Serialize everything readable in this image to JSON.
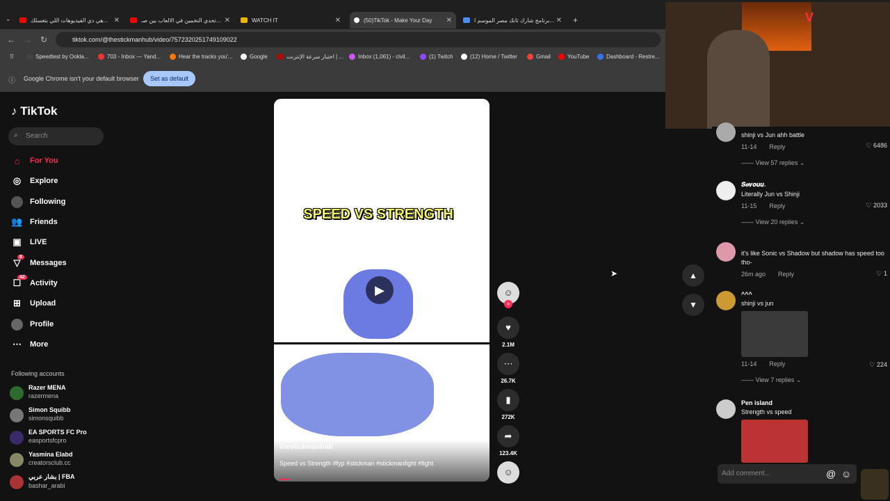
{
  "tabs": [
    {
      "label": "هي دي الفيديوهات اللي بتغسلك..."
    },
    {
      "label": "تحدي التخمين في الالعاب بين صـ..."
    },
    {
      "label": "WATCH IT"
    },
    {
      "label": "(50)TikTok - Make Your Day"
    },
    {
      "label": "برنامج شارك ثانك مصر الموسم ا..."
    }
  ],
  "url": "tiktok.com/@thestickmanhub/video/7572320251749109022",
  "bookmarks": [
    "Speedtest by Ookla...",
    "703 - Inbox — Yand...",
    "Hear the tracks you'...",
    "اختبار سرعة الإنترنت | ...",
    "Inbox (1,061) - civil...",
    "(1) Twitch",
    "(12) Home / Twitter",
    "Gmail",
    "YouTube",
    "Dashboard - Restre..."
  ],
  "infobar": {
    "text": "Google Chrome isn't your default browser",
    "button": "Set as default"
  },
  "sidebar": {
    "logo": "TikTok",
    "search_placeholder": "Search",
    "items": [
      {
        "label": "For You"
      },
      {
        "label": "Explore"
      },
      {
        "label": "Following"
      },
      {
        "label": "Friends"
      },
      {
        "label": "LIVE"
      },
      {
        "label": "Messages",
        "badge": "8"
      },
      {
        "label": "Activity",
        "badge": "42"
      },
      {
        "label": "Upload"
      },
      {
        "label": "Profile"
      },
      {
        "label": "More"
      }
    ],
    "following_title": "Following accounts",
    "accounts": [
      {
        "name": "Razer MENA",
        "user": "razermena"
      },
      {
        "name": "Simon Squibb",
        "user": "simonsquibb"
      },
      {
        "name": "EA SPORTS FC Pro",
        "user": "easportsfcpro"
      },
      {
        "name": "Yasmina Elabd",
        "user": "creatorsclub.cc"
      },
      {
        "name": "بشار عربي | FBA",
        "user": "bashar_arabi"
      }
    ]
  },
  "video": {
    "overlay_title": "SPEED VS STRENGTH",
    "author": "thestickmanhub",
    "caption": "Speed vs Strength #fyp #stickman #stickmanfight #fight"
  },
  "actions": {
    "likes": "2.1M",
    "comments": "26.7K",
    "saves": "272K",
    "shares": "123.4K"
  },
  "comments": [
    {
      "name": "",
      "text": "shinji vs Jun ahh battle",
      "date": "11-14",
      "reply": "Reply",
      "likes": "6486",
      "more": "View 57 replies"
    },
    {
      "name": "𝑺𝒆𝒗𝒐𝒖𝒖.",
      "text": "Literally Jun vs Shinji",
      "date": "11-15",
      "reply": "Reply",
      "likes": "2033",
      "more": "View 20 replies"
    },
    {
      "name": "",
      "text": "it's like Sonic vs Shadow but shadow has speed too tho-",
      "date": "26m ago",
      "reply": "Reply",
      "likes": "1",
      "more": ""
    },
    {
      "name": "^^^",
      "text": "shinji vs jun",
      "date": "11-14",
      "reply": "Reply",
      "likes": "224",
      "more": "View 7 replies"
    },
    {
      "name": "Pen island",
      "text": "Strength vs speed",
      "date": "",
      "reply": "",
      "likes": "",
      "more": ""
    }
  ],
  "add_comment": "Add comment..."
}
